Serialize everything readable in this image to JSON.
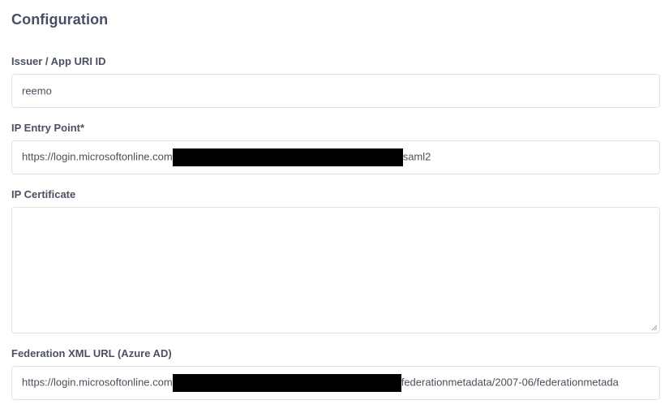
{
  "section": {
    "title": "Configuration"
  },
  "issuer": {
    "label": "Issuer / App URI ID",
    "value": "reemo"
  },
  "entry_point": {
    "label": "IP Entry Point*",
    "value_prefix": "https://login.microsoftonline.com",
    "value_suffix": "saml2"
  },
  "certificate": {
    "label": "IP Certificate",
    "value": ""
  },
  "federation": {
    "label": "Federation XML URL (Azure AD)",
    "value_prefix": "https://login.microsoftonline.com",
    "value_suffix": "federationmetadata/2007-06/federationmetada"
  },
  "colors": {
    "border": "#dfe2e7",
    "label_text": "#4a5161",
    "title_text": "#475063",
    "redaction": "#000000"
  }
}
